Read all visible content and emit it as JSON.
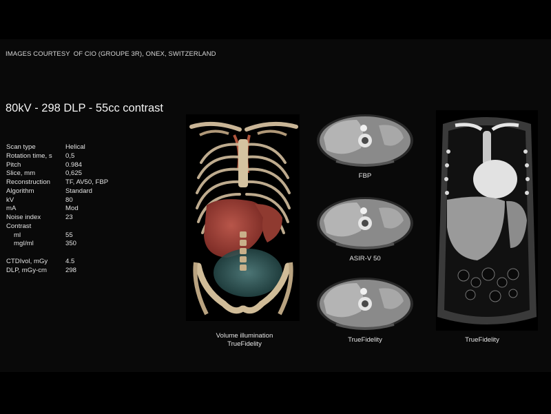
{
  "credit": {
    "prefix": "IMAGES COURTESY",
    "source": "OF CIO (GROUPE 3R), ONEX, SWITZERLAND"
  },
  "headline": "80kV - 298 DLP - 55cc contrast",
  "params": [
    {
      "label": "Scan type",
      "value": "Helical"
    },
    {
      "label": "Rotation time, s",
      "value": "0,5"
    },
    {
      "label": "Pitch",
      "value": "0.984"
    },
    {
      "label": "Slice, mm",
      "value": "0,625"
    },
    {
      "label": "Reconstruction",
      "value": "TF, AV50, FBP"
    },
    {
      "label": "Algorithm",
      "value": "Standard"
    },
    {
      "label": "kV",
      "value": "80"
    },
    {
      "label": "mA",
      "value": "Mod"
    },
    {
      "label": "Noise index",
      "value": "23"
    },
    {
      "label": "Contrast",
      "value": ""
    },
    {
      "label": "ml",
      "value": "55"
    },
    {
      "label": "mgI/ml",
      "value": "350"
    },
    {
      "label": "CTDIvol, mGy",
      "value": "4.5"
    },
    {
      "label": "DLP, mGy-cm",
      "value": "298"
    }
  ],
  "captions": {
    "volume_line1": "Volume illumination",
    "volume_line2": "TrueFidelity",
    "axial_fbp": "FBP",
    "axial_asir": "ASIR-V 50",
    "axial_tf": "TrueFidelity",
    "coronal": "TrueFidelity"
  },
  "colors": {
    "background": "#000000",
    "text": "#e8e8e8",
    "liver_render": "#a8453a",
    "bone_render": "#c9b596"
  }
}
